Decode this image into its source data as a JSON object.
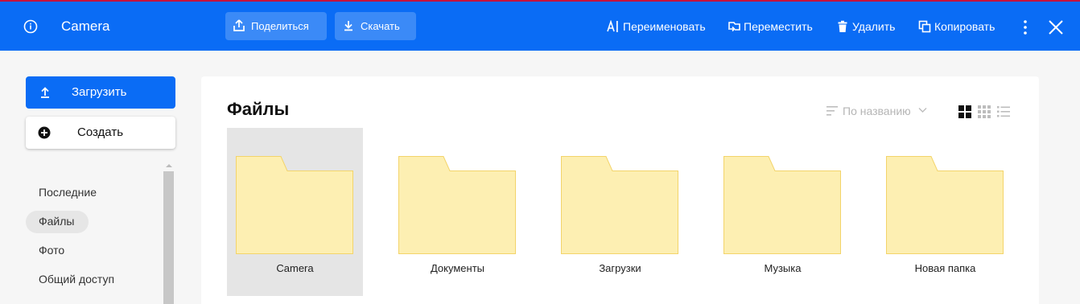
{
  "header": {
    "title": "Camera",
    "share_label": "Поделиться",
    "download_label": "Скачать",
    "actions": {
      "rename": "Переименовать",
      "move": "Переместить",
      "delete": "Удалить",
      "copy": "Копировать"
    }
  },
  "sidebar": {
    "upload_label": "Загрузить",
    "create_label": "Создать",
    "nav": [
      {
        "label": "Последние"
      },
      {
        "label": "Файлы",
        "active": true
      },
      {
        "label": "Фото"
      },
      {
        "label": "Общий доступ"
      }
    ]
  },
  "main": {
    "title": "Файлы",
    "sort_label": "По названию",
    "view_modes": [
      "large-tiles",
      "small-tiles",
      "list"
    ],
    "active_view": "large-tiles",
    "folders": [
      {
        "name": "Camera",
        "selected": true
      },
      {
        "name": "Документы"
      },
      {
        "name": "Загрузки"
      },
      {
        "name": "Музыка"
      },
      {
        "name": "Новая папка"
      }
    ]
  },
  "colors": {
    "header_bg": "#0a6cf5",
    "folder_fill": "#fdefb2",
    "folder_stroke": "#f3d46a",
    "selected_bg": "#e5e5e5"
  }
}
